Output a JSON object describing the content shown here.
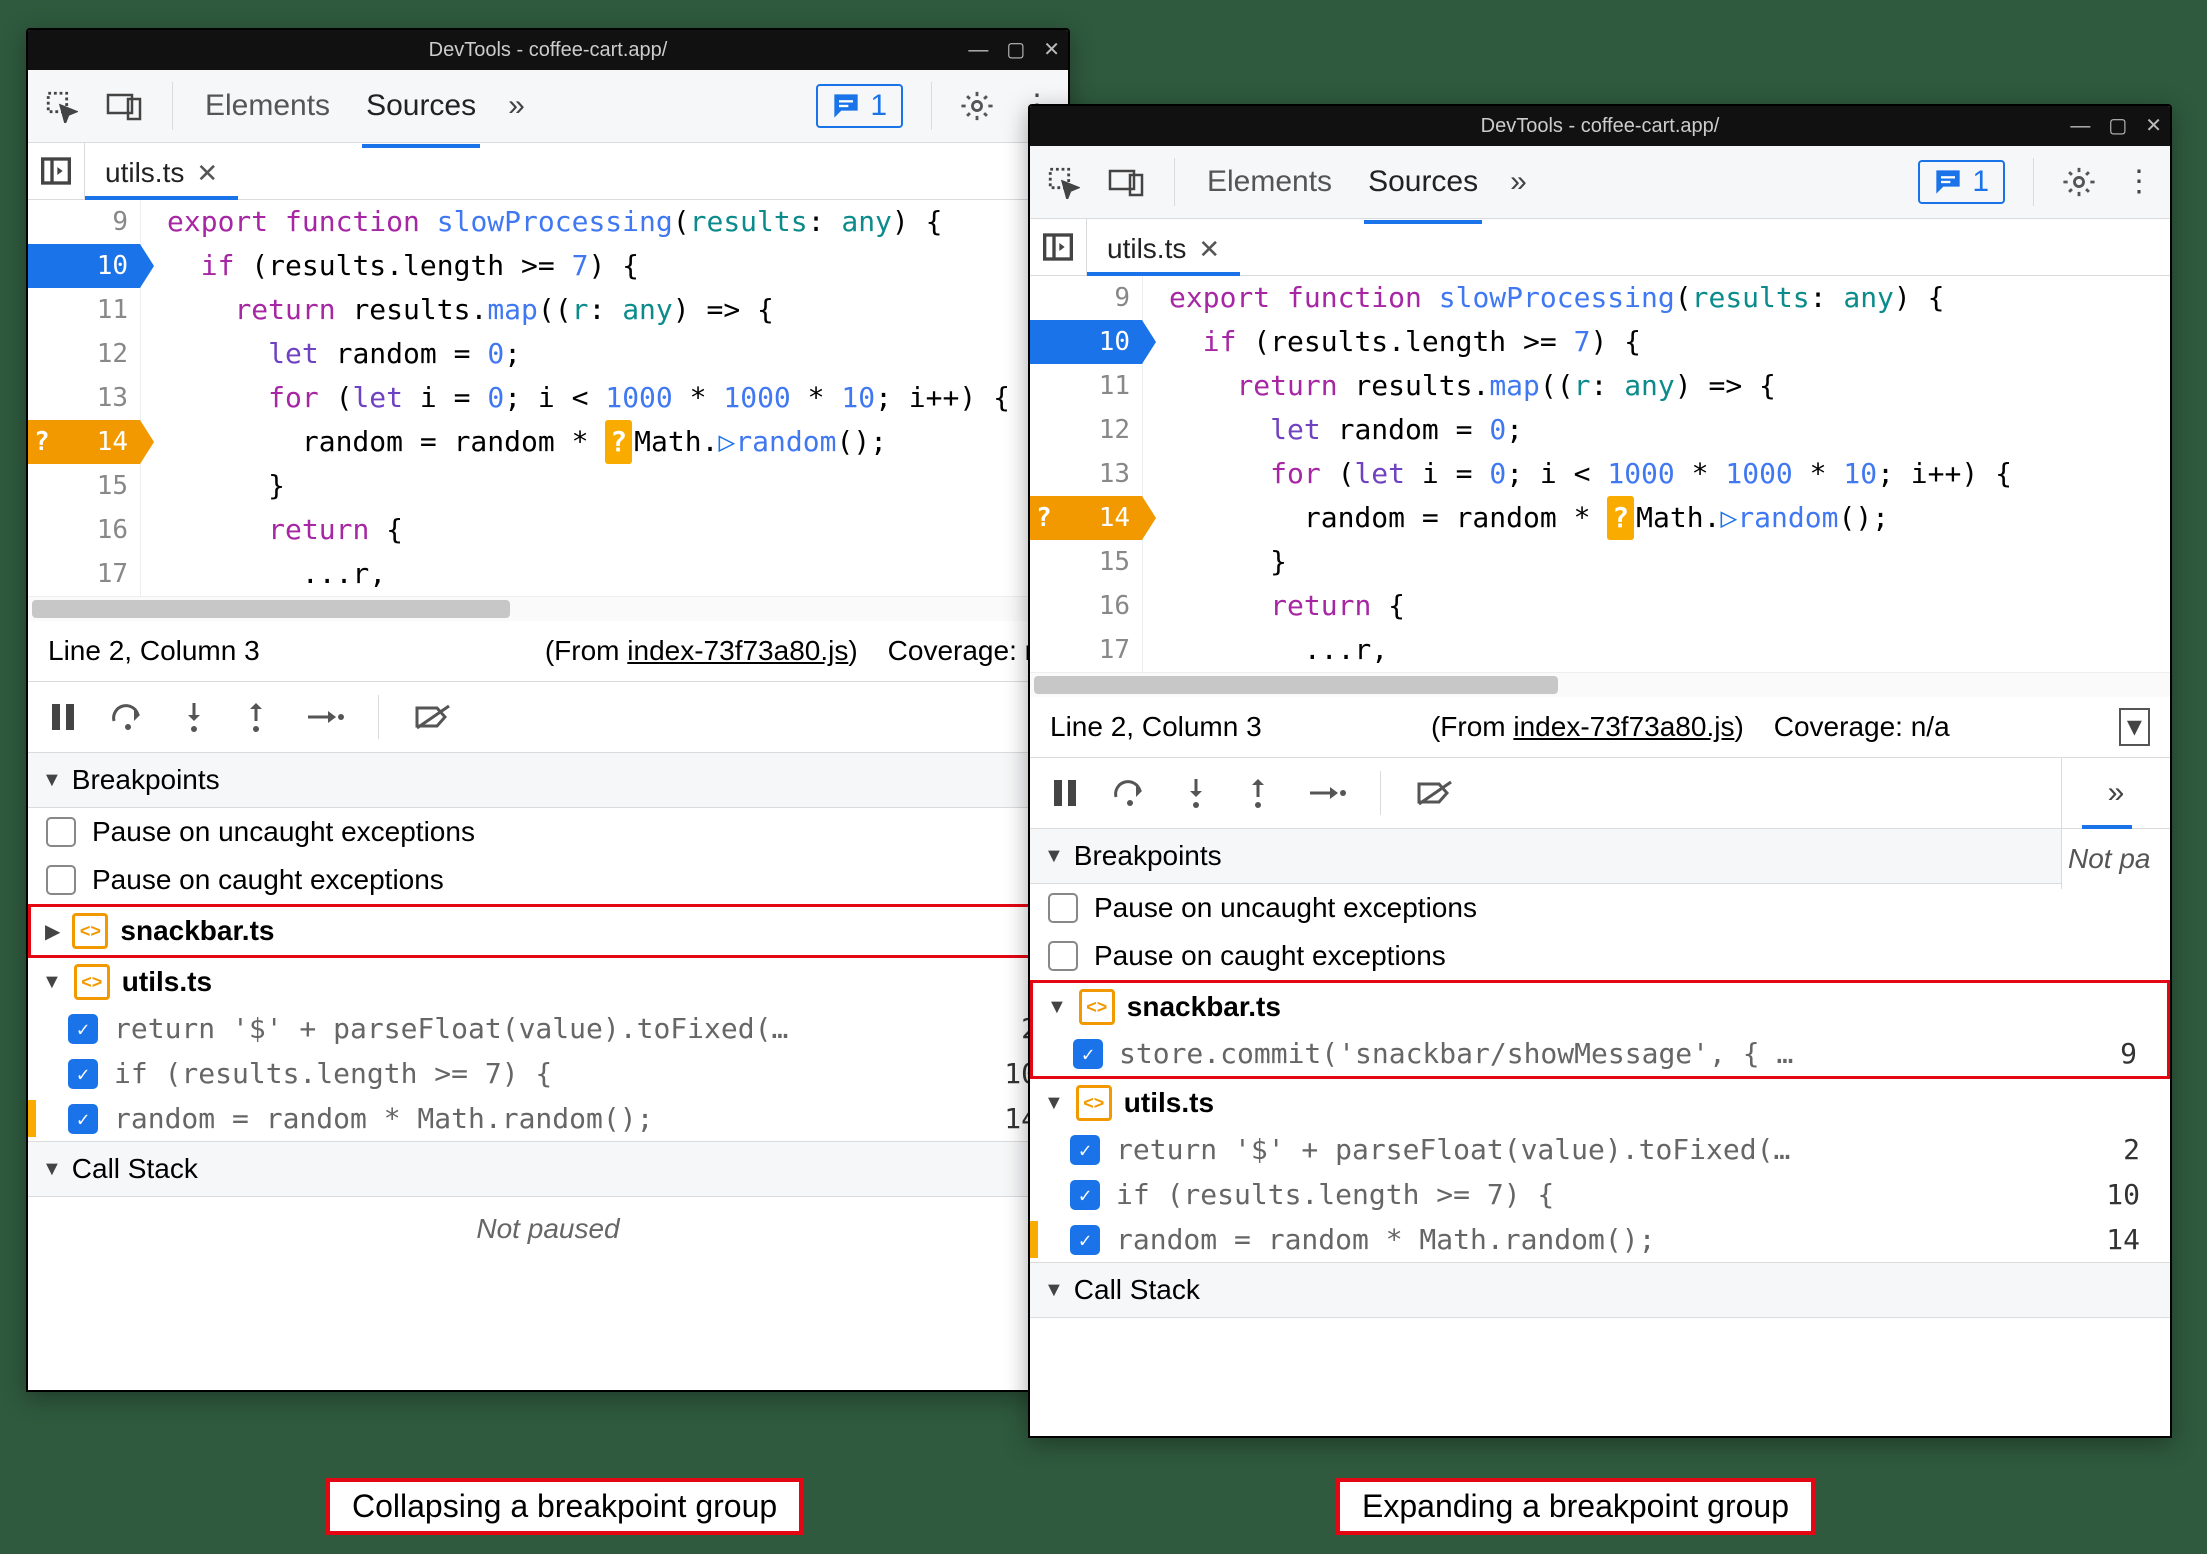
{
  "window_title": "DevTools - coffee-cart.app/",
  "toolbar": {
    "tabs": {
      "elements": "Elements",
      "sources": "Sources"
    },
    "issue_count": "1"
  },
  "file_tab": {
    "name": "utils.ts"
  },
  "code": {
    "lines": [
      {
        "n": "9",
        "html": "<span class='kw'>export</span> <span class='kw'>function</span> <span class='fn'>slowProcessing</span>(<span class='ty'>results</span>: <span class='ty'>any</span>) {"
      },
      {
        "n": "10",
        "bp": "blue",
        "html": "  <span class='kw'>if</span> (results.length &gt;= <span class='nm'>7</span>) {"
      },
      {
        "n": "11",
        "html": "    <span class='kw'>return</span> results.<span class='fn'>map</span>((<span class='ty'>r</span>: <span class='ty'>any</span>) =&gt; {"
      },
      {
        "n": "12",
        "html": "      <span class='lt'>let</span> random = <span class='nm'>0</span>;"
      },
      {
        "n": "13",
        "html": "      <span class='kw'>for</span> (<span class='lt'>let</span> i = <span class='nm'>0</span>; i &lt; <span class='nm'>1000</span> * <span class='nm'>1000</span> * <span class='nm'>10</span>; i++) {"
      },
      {
        "n": "14",
        "bp": "orange",
        "html": "        random = random * <span class='inline-mark-orange'>?</span>Math.<span class='inline-mark-blue'>▷</span><span class='fn'>random</span>();"
      },
      {
        "n": "15",
        "html": "      }"
      },
      {
        "n": "16",
        "html": "      <span class='kw'>return</span> {"
      },
      {
        "n": "17",
        "html": "        ...r,"
      }
    ]
  },
  "status": {
    "position": "Line 2, Column 3",
    "from_prefix": "(From ",
    "from_file": "index-73f73a80.js",
    "from_suffix": ")",
    "coverage_left": "Coverage: n/",
    "coverage_right": "Coverage: n/a"
  },
  "breakpoints": {
    "header": "Breakpoints",
    "pause_uncaught": "Pause on uncaught exceptions",
    "pause_caught": "Pause on caught exceptions",
    "group_snackbar": "snackbar.ts",
    "group_utils": "utils.ts",
    "snackbar_item": {
      "code": "store.commit('snackbar/showMessage', { …",
      "line": "9"
    },
    "utils_items": [
      {
        "code": "return '$' + parseFloat(value).toFixed(…",
        "line": "2"
      },
      {
        "code": "if (results.length >= 7) {",
        "line": "10"
      },
      {
        "code": "random = random * Math.random();",
        "line": "14",
        "orange": true
      }
    ],
    "call_stack": "Call Stack",
    "not_paused": "Not paused",
    "right_not_paused": "Not pa"
  },
  "captions": {
    "left": "Collapsing a breakpoint group",
    "right": "Expanding a breakpoint group"
  }
}
